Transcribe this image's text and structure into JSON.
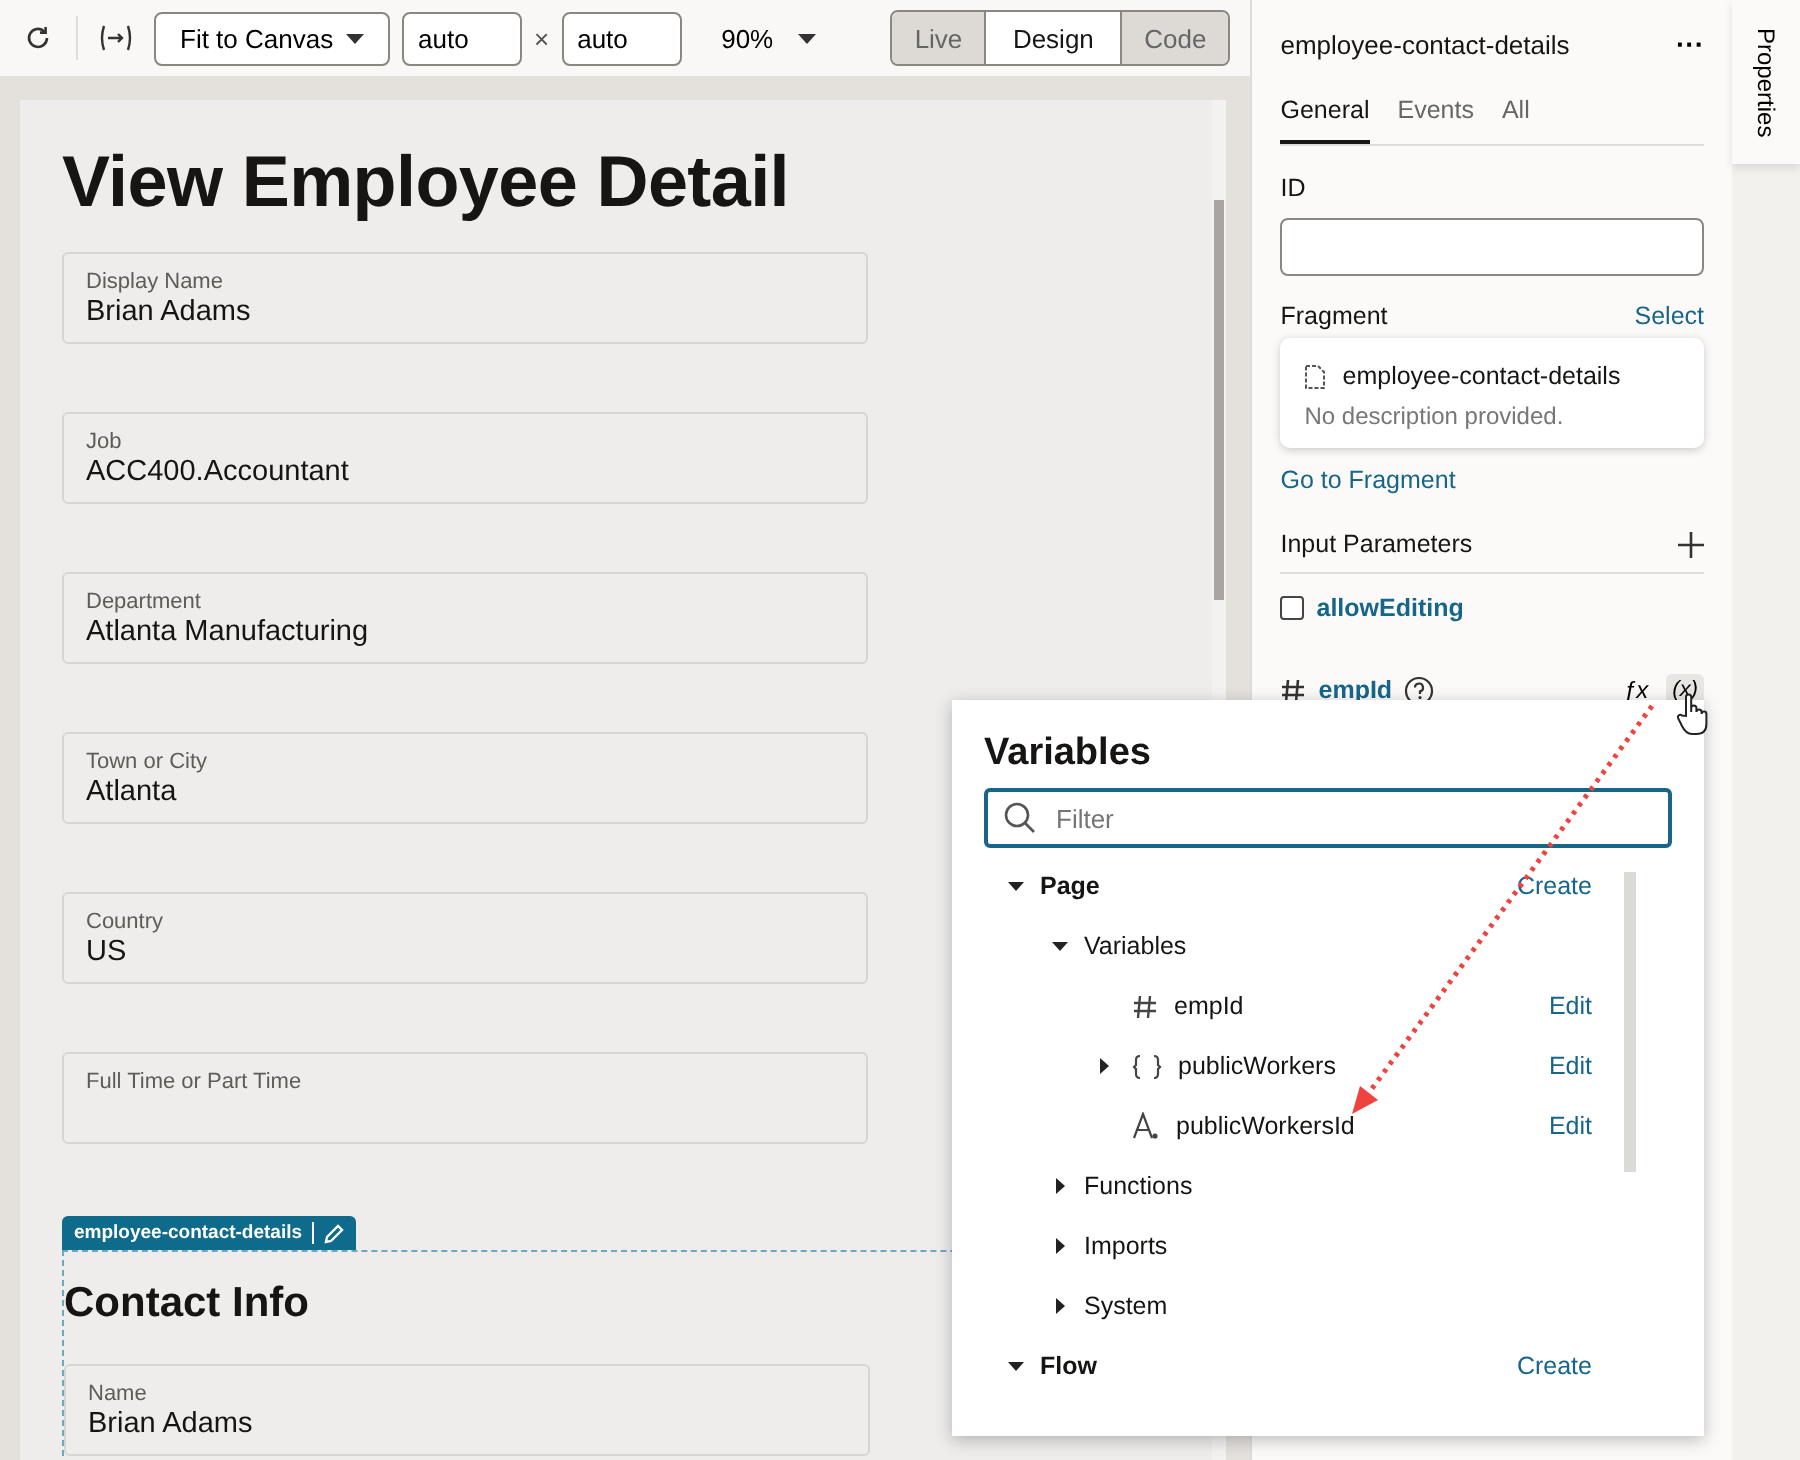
{
  "toolbar": {
    "fit": "Fit to Canvas",
    "width": "auto",
    "times": "×",
    "height": "auto",
    "zoom": "90%",
    "modes": [
      {
        "label": "Live",
        "selected": false
      },
      {
        "label": "Design",
        "selected": true
      },
      {
        "label": "Code",
        "selected": false
      }
    ]
  },
  "canvas": {
    "title": "View Employee Detail",
    "fields": [
      {
        "label": "Display Name",
        "value": "Brian Adams"
      },
      {
        "label": "Job",
        "value": "ACC400.Accountant"
      },
      {
        "label": "Department",
        "value": "Atlanta Manufacturing"
      },
      {
        "label": "Town or City",
        "value": "Atlanta"
      },
      {
        "label": "Country",
        "value": "US"
      },
      {
        "label": "Full Time or Part Time"
      }
    ],
    "fragment_tag": "employee-contact-details",
    "fragment_title": "Contact Info",
    "fragment_fields": [
      {
        "label": "Name",
        "value": "Brian Adams"
      }
    ]
  },
  "panel": {
    "title": "employee-contact-details",
    "more": "···",
    "tabs": [
      {
        "label": "General",
        "selected": true
      },
      {
        "label": "Events",
        "selected": false
      },
      {
        "label": "All",
        "selected": false
      }
    ],
    "id_label": "ID",
    "fragment_label": "Fragment",
    "select_link": "Select",
    "fragment_name": "employee-contact-details",
    "fragment_desc": "No description provided.",
    "goto_link": "Go to Fragment",
    "input_params": "Input Parameters",
    "params": [
      {
        "kind": "boolean",
        "name": "allowEditing",
        "checked": false
      },
      {
        "kind": "number",
        "name": "empId"
      }
    ],
    "fx": "ƒx",
    "var_button": "(x)"
  },
  "side_tab": "Properties",
  "variables_popup": {
    "title": "Variables",
    "filter_placeholder": "Filter",
    "tree": [
      {
        "label": "Page",
        "bold": true,
        "expanded": true,
        "action": "Create",
        "children": [
          {
            "label": "Variables",
            "expanded": true,
            "children": [
              {
                "label": "empId",
                "kind": "number",
                "action": "Edit"
              },
              {
                "label": "publicWorkers",
                "kind": "object",
                "expanded": false,
                "action": "Edit"
              },
              {
                "label": "publicWorkersId",
                "kind": "string",
                "action": "Edit"
              }
            ]
          },
          {
            "label": "Functions",
            "expanded": false
          },
          {
            "label": "Imports",
            "expanded": false
          },
          {
            "label": "System",
            "expanded": false
          }
        ]
      },
      {
        "label": "Flow",
        "bold": true,
        "expanded": true,
        "action": "Create"
      }
    ]
  }
}
